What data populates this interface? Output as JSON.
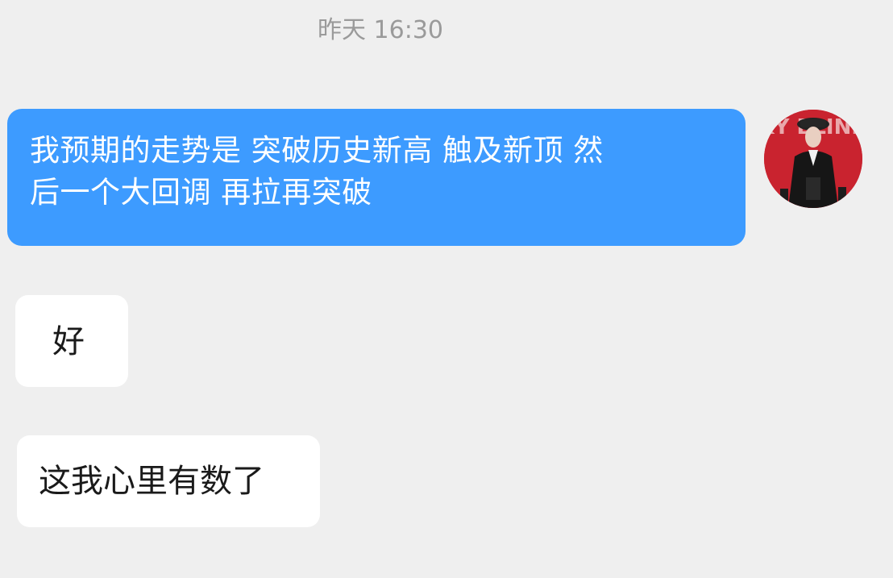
{
  "chat": {
    "timestamp": "昨天 16:30",
    "messages": [
      {
        "direction": "outgoing",
        "lines": [
          "我预期的走势是 突破历史新高 触及新顶 然",
          "后一个大回调 再拉再突破"
        ]
      },
      {
        "direction": "incoming",
        "text": "好"
      },
      {
        "direction": "incoming",
        "text": "这我心里有数了"
      }
    ],
    "avatar": {
      "text": "PEAKY BLINDERS",
      "icon": "user-avatar"
    }
  },
  "colors": {
    "background": "#efefef",
    "outgoing_bubble": "#3d9bff",
    "incoming_bubble": "#ffffff",
    "timestamp_text": "#9a9a9a"
  }
}
